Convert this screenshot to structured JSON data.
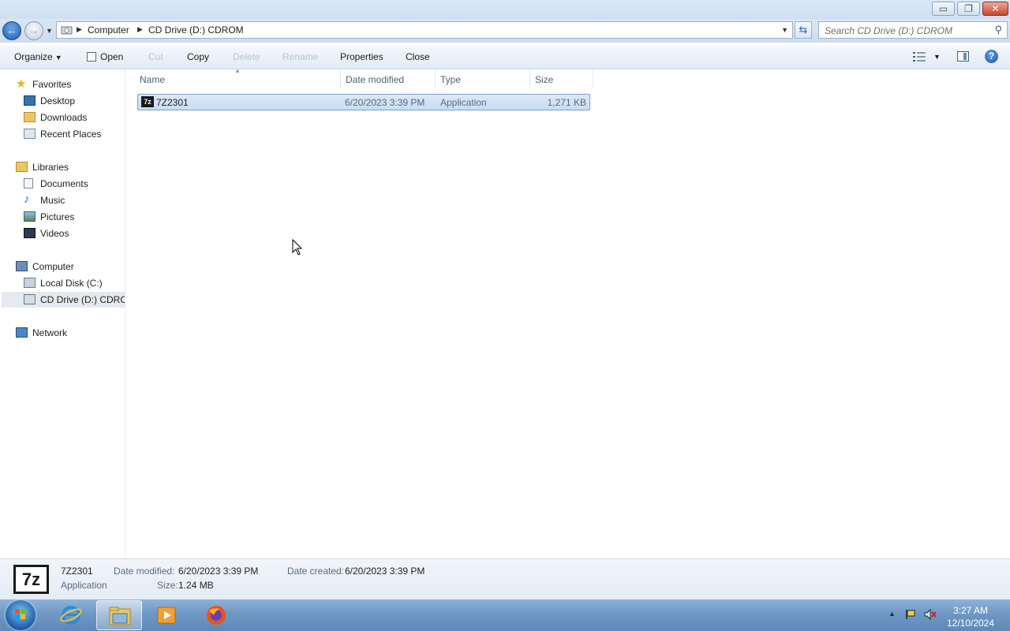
{
  "window": {
    "controls": {
      "minimize": "▭",
      "maximize": "❐",
      "close": "✕"
    }
  },
  "address": {
    "crumbs": [
      "Computer",
      "CD Drive (D:) CDROM"
    ],
    "search_placeholder": "Search CD Drive (D:) CDROM"
  },
  "toolbar": {
    "organize": "Organize",
    "open": "Open",
    "cut": "Cut",
    "copy": "Copy",
    "delete": "Delete",
    "rename": "Rename",
    "properties": "Properties",
    "close": "Close"
  },
  "nav": {
    "favorites": "Favorites",
    "desktop": "Desktop",
    "downloads": "Downloads",
    "recent_places": "Recent Places",
    "libraries": "Libraries",
    "documents": "Documents",
    "music": "Music",
    "pictures": "Pictures",
    "videos": "Videos",
    "computer": "Computer",
    "local_disk": "Local Disk (C:)",
    "cd_drive": "CD Drive (D:) CDROM",
    "network": "Network"
  },
  "columns": {
    "name": "Name",
    "date_modified": "Date modified",
    "type": "Type",
    "size": "Size"
  },
  "files": [
    {
      "name": "7Z2301",
      "date_modified": "6/20/2023 3:39 PM",
      "type": "Application",
      "size": "1,271 KB",
      "icon_label": "7z"
    }
  ],
  "details": {
    "icon_label": "7z",
    "name": "7Z2301",
    "type": "Application",
    "date_modified_label": "Date modified:",
    "date_modified": "6/20/2023 3:39 PM",
    "date_created_label": "Date created:",
    "date_created": "6/20/2023 3:39 PM",
    "size_label": "Size:",
    "size": "1.24 MB"
  },
  "taskbar": {
    "time": "3:27 AM",
    "date": "12/10/2024"
  },
  "colors": {
    "accent": "#3399ff",
    "selection": "#cce0f7",
    "taskbar": "#6e97c4"
  }
}
